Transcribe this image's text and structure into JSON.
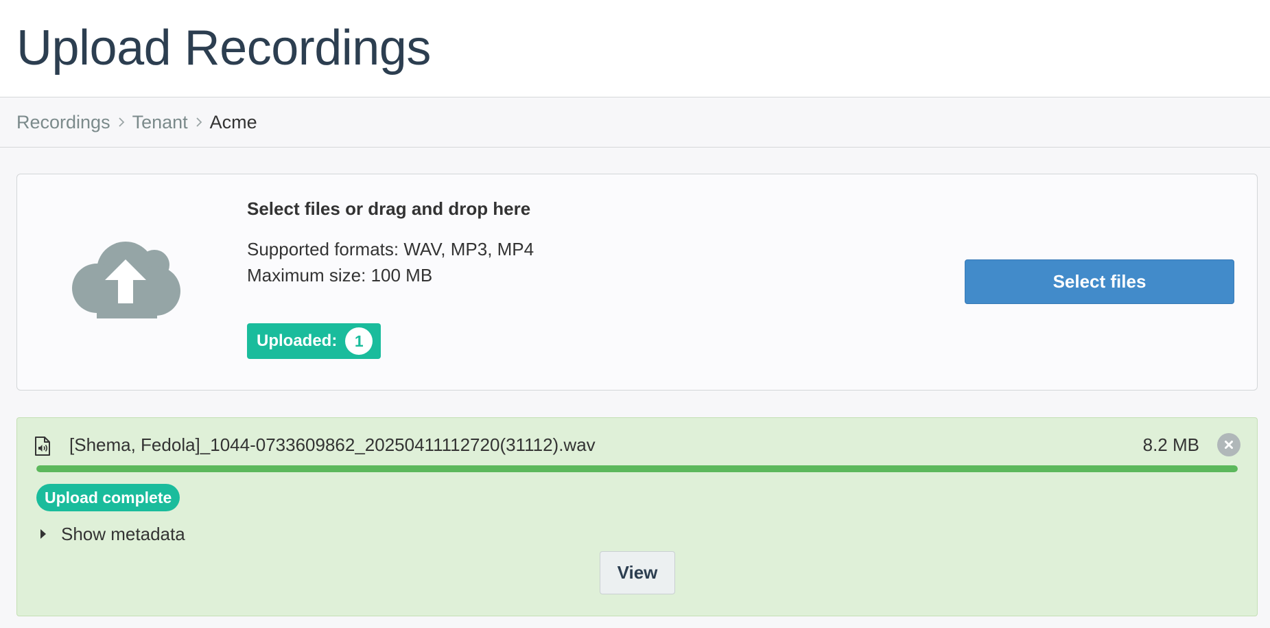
{
  "page": {
    "title": "Upload Recordings"
  },
  "breadcrumb": {
    "items": [
      "Recordings",
      "Tenant",
      "Acme"
    ]
  },
  "dropzone": {
    "icon": "cloud-upload-icon",
    "title": "Select files or drag and drop here",
    "formats": "Supported formats: WAV, MP3, MP4",
    "max_size": "Maximum size: 100 MB",
    "uploaded_label": "Uploaded:",
    "uploaded_count": "1",
    "select_button_label": "Select files"
  },
  "file": {
    "icon": "audio-file-icon",
    "name": "[Shema, Fedola]_1044-0733609862_20250411112720(31112).wav",
    "size": "8.2 MB",
    "progress_percent": 100,
    "status": "Upload complete",
    "metadata_toggle_label": "Show metadata",
    "view_button_label": "View"
  },
  "colors": {
    "primary": "#428bca",
    "success_badge": "#1abc9c",
    "progress": "#5cb85c",
    "file_card_bg": "#dff0d8",
    "title_text": "#2c3e50"
  }
}
